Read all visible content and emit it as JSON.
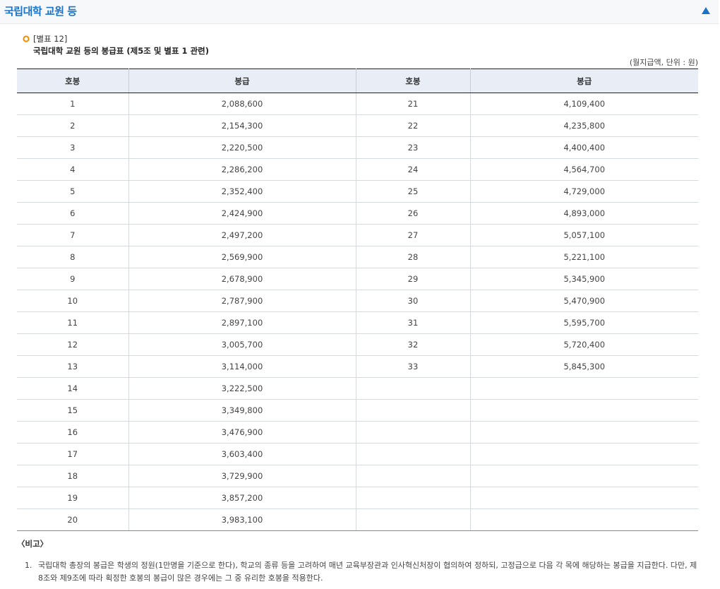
{
  "header": {
    "title": "국립대학 교원 등",
    "accent_color": "#1a73c8",
    "toggle_icon": "triangle-up-icon"
  },
  "section": {
    "bullet_icon": "orange-circle-icon",
    "bullet_color": "#f08c00",
    "table_no": "[별표 12]",
    "table_title": "국립대학 교원 등의 봉급표 (제5조 및 별표 1 관련)",
    "unit_note": "(월지급액, 단위 : 원)"
  },
  "table": {
    "headers": [
      "호봉",
      "봉급",
      "호봉",
      "봉급"
    ],
    "rows": [
      [
        "1",
        "2,088,600",
        "21",
        "4,109,400"
      ],
      [
        "2",
        "2,154,300",
        "22",
        "4,235,800"
      ],
      [
        "3",
        "2,220,500",
        "23",
        "4,400,400"
      ],
      [
        "4",
        "2,286,200",
        "24",
        "4,564,700"
      ],
      [
        "5",
        "2,352,400",
        "25",
        "4,729,000"
      ],
      [
        "6",
        "2,424,900",
        "26",
        "4,893,000"
      ],
      [
        "7",
        "2,497,200",
        "27",
        "5,057,100"
      ],
      [
        "8",
        "2,569,900",
        "28",
        "5,221,100"
      ],
      [
        "9",
        "2,678,900",
        "29",
        "5,345,900"
      ],
      [
        "10",
        "2,787,900",
        "30",
        "5,470,900"
      ],
      [
        "11",
        "2,897,100",
        "31",
        "5,595,700"
      ],
      [
        "12",
        "3,005,700",
        "32",
        "5,720,400"
      ],
      [
        "13",
        "3,114,000",
        "33",
        "5,845,300"
      ],
      [
        "14",
        "3,222,500",
        "",
        ""
      ],
      [
        "15",
        "3,349,800",
        "",
        ""
      ],
      [
        "16",
        "3,476,900",
        "",
        ""
      ],
      [
        "17",
        "3,603,400",
        "",
        ""
      ],
      [
        "18",
        "3,729,900",
        "",
        ""
      ],
      [
        "19",
        "3,857,200",
        "",
        ""
      ],
      [
        "20",
        "3,983,100",
        "",
        ""
      ]
    ]
  },
  "remarks": {
    "label": "〈비고〉",
    "items": [
      {
        "num": "1.",
        "text": "국립대학 총장의 봉급은 학생의 정원(1만명을 기준으로 한다), 학교의 종류 등을 고려하여 매년 교육부장관과 인사혁신처장이 협의하여 정하되, 고정급으로 다음 각 목에 해당하는 봉급을 지급한다. 다만, 제8조와 제9조에 따라 획정한 호봉의 봉급이 많은 경우에는 그 중 유리한 호봉을 적용한다."
      }
    ]
  }
}
